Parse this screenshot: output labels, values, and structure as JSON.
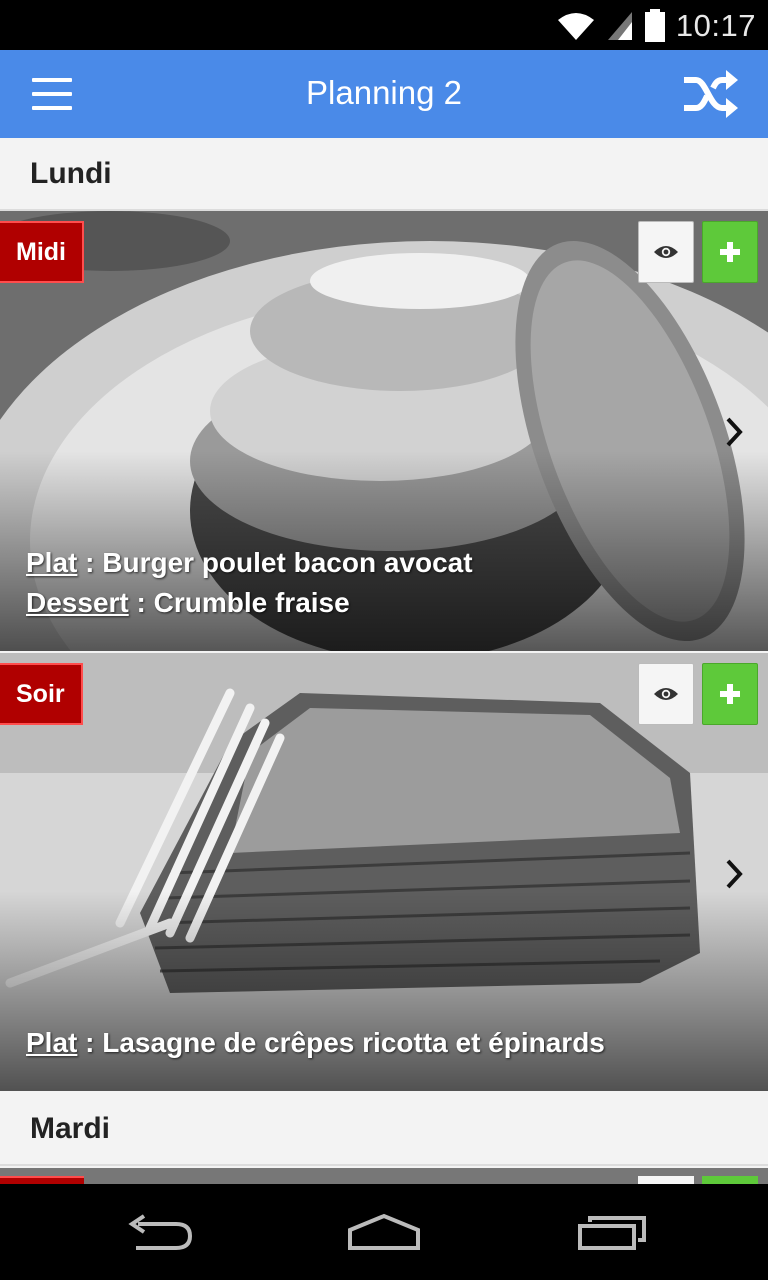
{
  "status_bar": {
    "time": "10:17"
  },
  "app_bar": {
    "title": "Planning 2"
  },
  "days": [
    {
      "label": "Lundi",
      "meals": [
        {
          "badge": "Midi",
          "dishes": [
            {
              "label": "Plat",
              "separator": " : ",
              "value": "Burger poulet bacon avocat"
            },
            {
              "label": "Dessert",
              "separator": " : ",
              "value": "Crumble fraise"
            }
          ]
        },
        {
          "badge": "Soir",
          "dishes": [
            {
              "label": "Plat",
              "separator": " : ",
              "value": "Lasagne de crêpes ricotta et épinards"
            }
          ]
        }
      ]
    },
    {
      "label": "Mardi"
    }
  ],
  "colors": {
    "app_bar": "#4a8ae8",
    "badge": "#b00000",
    "add_button": "#5ec93a"
  },
  "icons": {
    "menu": "hamburger-icon",
    "shuffle": "shuffle-icon",
    "view": "eye-icon",
    "add": "plus-icon",
    "next": "chevron-right-icon",
    "back": "back-icon",
    "home": "home-icon",
    "recents": "recents-icon"
  }
}
